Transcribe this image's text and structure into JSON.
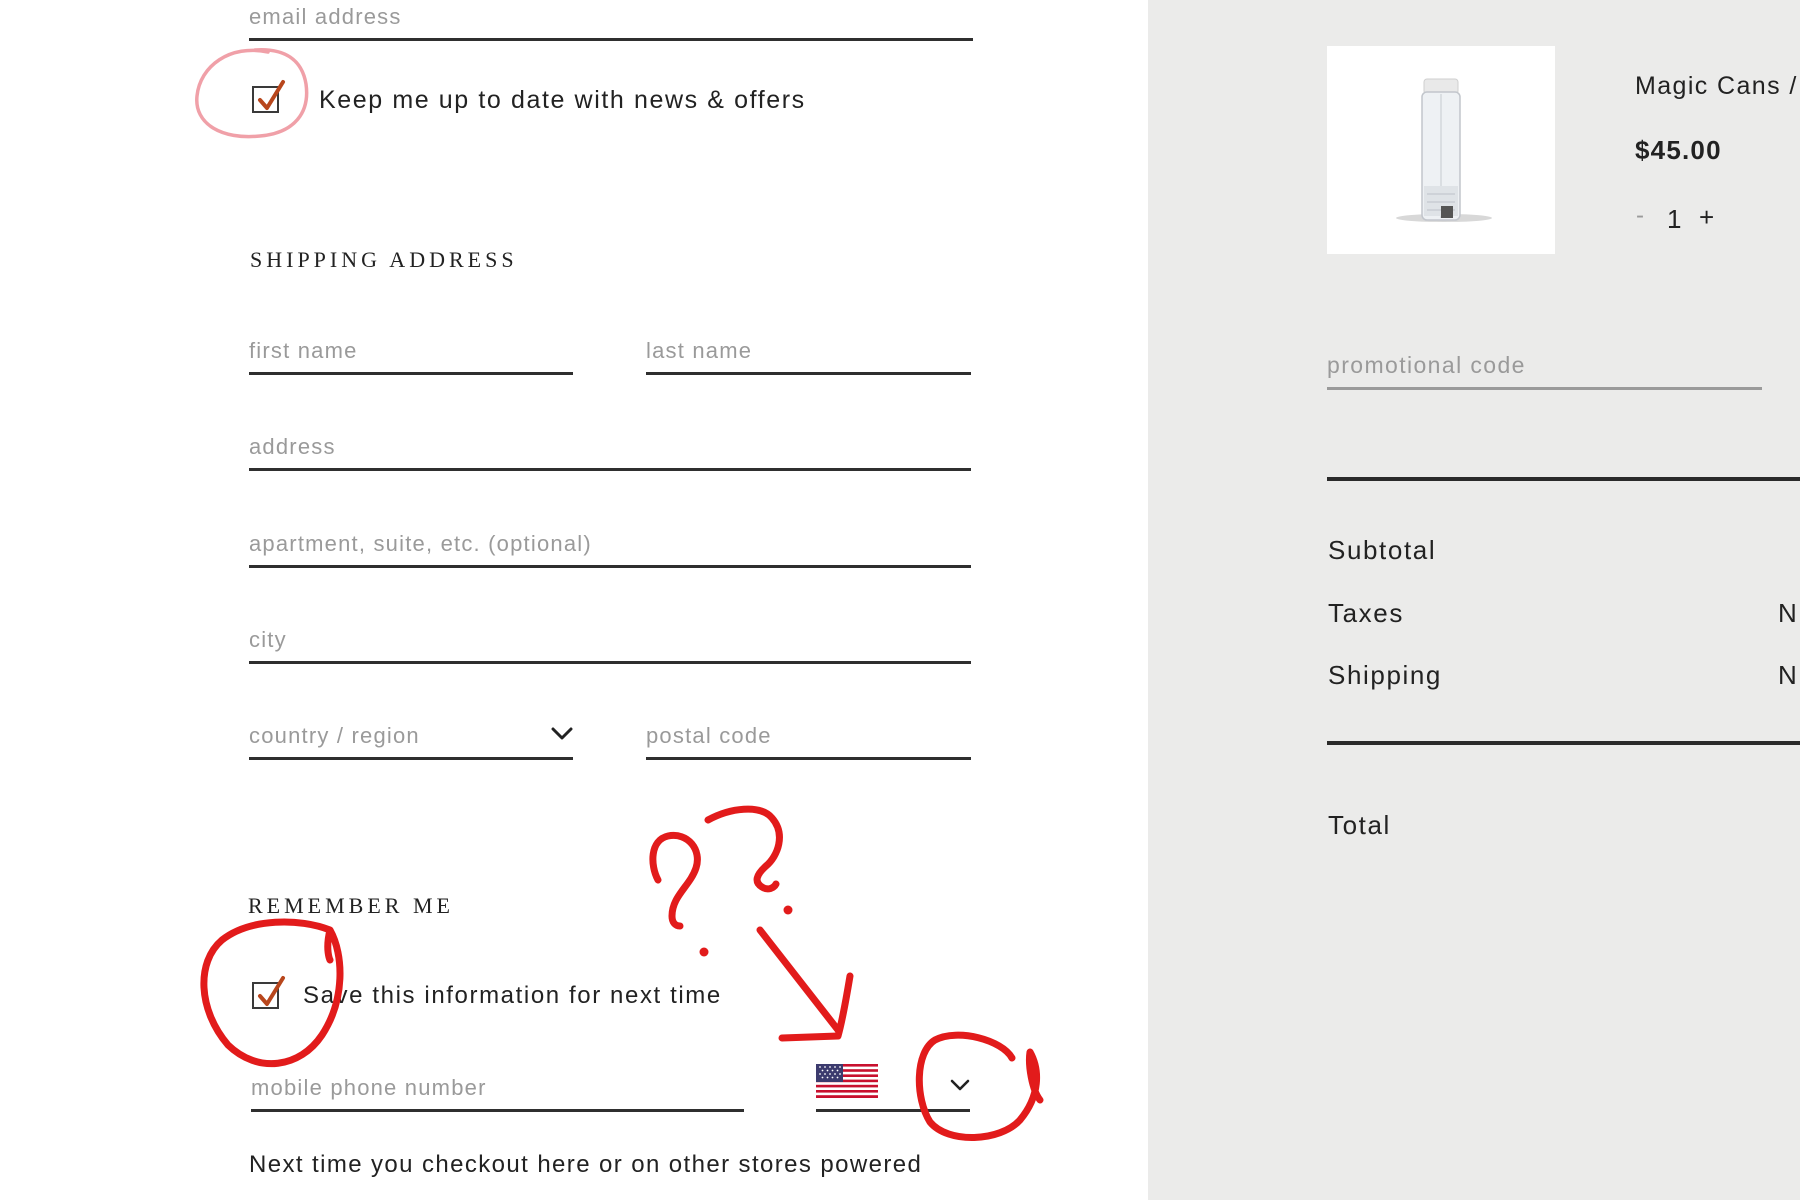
{
  "contact": {
    "email_placeholder": "email address",
    "newsletter_label": "Keep me up to date with news & offers"
  },
  "shipping": {
    "title": "SHIPPING ADDRESS",
    "first_name_placeholder": "first name",
    "last_name_placeholder": "last name",
    "address_placeholder": "address",
    "apartment_placeholder": "apartment, suite, etc. (optional)",
    "city_placeholder": "city",
    "country_placeholder": "country / region",
    "postal_placeholder": "postal code"
  },
  "remember": {
    "title": "REMEMBER ME",
    "save_label": "Save this information for next time",
    "phone_placeholder": "mobile phone number",
    "country_flag_icon": "us-flag-icon",
    "note": "Next time you checkout here or on other stores powered"
  },
  "cart": {
    "product_name": "Magic Cans /",
    "price": "$45.00",
    "qty_minus": "-",
    "quantity": "1",
    "qty_plus": "+",
    "promo_placeholder": "promotional code"
  },
  "summary": {
    "subtotal_label": "Subtotal",
    "taxes_label": "Taxes",
    "taxes_value": "N",
    "shipping_label": "Shipping",
    "shipping_value": "N",
    "total_label": "Total"
  },
  "annotations": {
    "question_marks": "??"
  },
  "colors": {
    "check": "#b8461c",
    "annotation_red": "#e21b1b",
    "annotation_pink": "#f0a0a8",
    "right_pane_bg": "#ebebea",
    "field_line": "#2f2f2f"
  }
}
